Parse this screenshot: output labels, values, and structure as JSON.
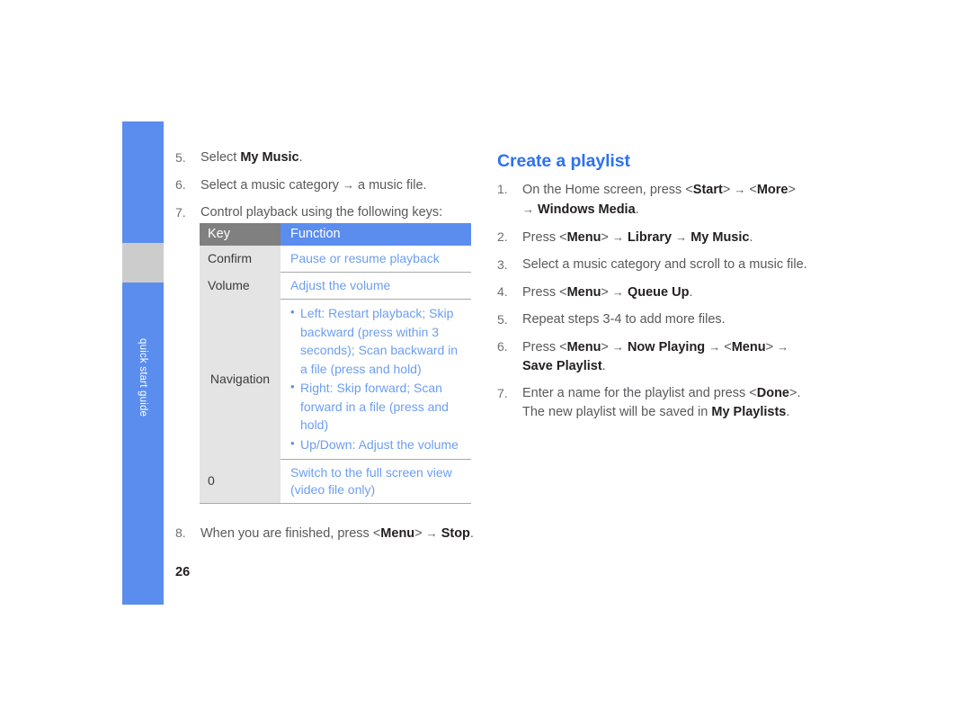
{
  "sidebar": {
    "label": "quick start guide",
    "blue_color": "#5b8def",
    "gray_color": "#cccccc"
  },
  "page_number": "26",
  "left_column": {
    "steps": [
      {
        "num": "5.",
        "html": "Select <b>My Music</b>."
      },
      {
        "num": "6.",
        "html": "Select a music category <span class=\"arrow\">→</span> a music file."
      },
      {
        "num": "7.",
        "html": "Control playback using the following keys:"
      }
    ],
    "final_step": {
      "num": "8.",
      "html": "When you are finished, press &lt;<b>Menu</b>&gt; <span class=\"arrow\">→</span> <b>Stop</b>."
    }
  },
  "key_table": {
    "header_key": "Key",
    "header_function": "Function",
    "header_key_bg": "#808080",
    "header_function_bg": "#5b8def",
    "cell_key_bg": "#e4e4e4",
    "function_text_color": "#6c9ef0",
    "rows": [
      {
        "key": "Confirm",
        "function_text": "Pause or resume playback",
        "bullets": []
      },
      {
        "key": "Volume",
        "function_text": "Adjust the volume",
        "bullets": []
      },
      {
        "key": "Navigation",
        "function_text": "",
        "bullets": [
          "Left: Restart playback; Skip backward (press within 3 seconds); Scan backward in a file (press and hold)",
          "Right: Skip forward; Scan forward in a file (press and hold)",
          "Up/Down: Adjust the volume"
        ]
      },
      {
        "key": "0",
        "function_text": "Switch to the full screen view (video file only)",
        "bullets": []
      }
    ]
  },
  "right_column": {
    "heading": "Create a playlist",
    "heading_color": "#2e71f0",
    "steps": [
      {
        "num": "1.",
        "html": "On the Home screen, press &lt;<b>Start</b>&gt; <span class=\"arrow\">→</span> &lt;<b>More</b>&gt; <span class=\"arrow\">→</span> <b>Windows Media</b>."
      },
      {
        "num": "2.",
        "html": "Press &lt;<b>Menu</b>&gt; <span class=\"arrow\">→</span> <b>Library</b> <span class=\"arrow\">→</span> <b>My Music</b>."
      },
      {
        "num": "3.",
        "html": "Select a music category and scroll to a music file."
      },
      {
        "num": "4.",
        "html": "Press &lt;<b>Menu</b>&gt; <span class=\"arrow\">→</span> <b>Queue Up</b>."
      },
      {
        "num": "5.",
        "html": "Repeat steps 3-4 to add more files."
      },
      {
        "num": "6.",
        "html": "Press &lt;<b>Menu</b>&gt; <span class=\"arrow\">→</span> <b>Now Playing</b> <span class=\"arrow\">→</span> &lt;<b>Menu</b>&gt; <span class=\"arrow\">→</span> <b>Save Playlist</b>."
      },
      {
        "num": "7.",
        "html": "Enter a name for the playlist and press &lt;<b>Done</b>&gt;.<br>The new playlist will be saved in <b>My Playlists</b>."
      }
    ]
  }
}
